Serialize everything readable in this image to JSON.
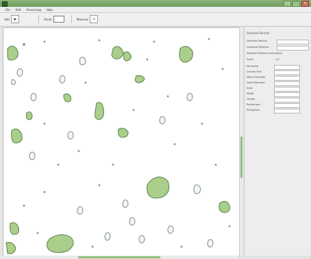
{
  "window": {
    "title": "",
    "controls": [
      "_",
      "□",
      "×"
    ]
  },
  "menu": [
    "File",
    "Edit",
    "Processing",
    "Help"
  ],
  "toolbar": {
    "tool_a": "Add",
    "tool_b": "Zoom",
    "tool_c": "Measure"
  },
  "panel": {
    "heading": "Selected Particle",
    "rows": [
      {
        "label": "Selected Particle",
        "value": ""
      },
      {
        "label": "Coloured Particles",
        "value": ""
      },
      {
        "label": "Selected Particle Information",
        "value": ""
      },
      {
        "label": "Scale",
        "value": "1.0"
      },
      {
        "label": "Perimeter",
        "value": ""
      },
      {
        "label": "Convex Hull",
        "value": ""
      },
      {
        "label": "Mean Diameter",
        "value": ""
      },
      {
        "label": "Feret Diameter",
        "value": ""
      },
      {
        "label": "Area",
        "value": ""
      },
      {
        "label": "Width",
        "value": ""
      },
      {
        "label": "Length",
        "value": ""
      },
      {
        "label": "Roundness",
        "value": ""
      },
      {
        "label": "Elongation",
        "value": ""
      }
    ]
  },
  "colors": {
    "particle_fill": "#a9cf8a",
    "particle_stroke": "#6b8f5b",
    "dot": "#8a9aa8"
  }
}
